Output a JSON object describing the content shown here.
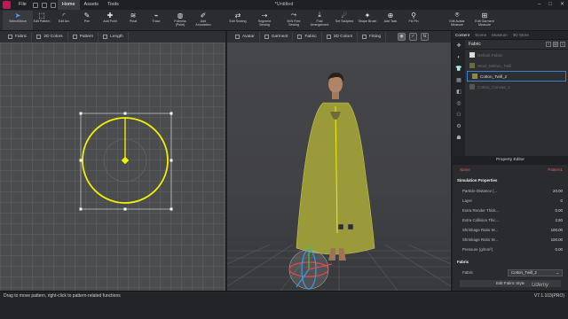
{
  "menubar": {
    "items": [
      "File",
      "Home",
      "Assets",
      "Tools"
    ],
    "active": "Home",
    "doc_title": "*Untitled",
    "window_buttons": [
      "–",
      "□",
      "✕"
    ]
  },
  "toolbar": {
    "tools": [
      {
        "label": "Select/Move",
        "icon": "cursor-icon",
        "glyph": "➤"
      },
      {
        "label": "Edit Pattern",
        "icon": "edit-pattern-icon",
        "glyph": "⬚"
      },
      {
        "label": "Edit Arc",
        "icon": "edit-arc-icon",
        "glyph": "◜"
      },
      {
        "label": "Pen",
        "icon": "pen-icon",
        "glyph": "✎"
      },
      {
        "label": "Add Point",
        "icon": "add-point-icon",
        "glyph": "✚"
      },
      {
        "label": "Pleat",
        "icon": "pleat-icon",
        "glyph": "≋"
      },
      {
        "label": "Trace",
        "icon": "trace-icon",
        "glyph": "⌁"
      },
      {
        "label": "Fullness\n(Point)",
        "icon": "fullness-icon",
        "glyph": "◍"
      },
      {
        "label": "Add\nAnnotation",
        "icon": "annotation-icon",
        "glyph": "✐"
      },
      {
        "label": "Edit Sewing",
        "icon": "edit-sewing-icon",
        "glyph": "⇄"
      },
      {
        "label": "Segment\nSewing",
        "icon": "segment-sewing-icon",
        "glyph": "⇢"
      },
      {
        "label": "M:N Free\nSewing",
        "icon": "free-sewing-icon",
        "glyph": "⤳"
      },
      {
        "label": "Fold\nArrangement",
        "icon": "fold-icon",
        "glyph": "⤓"
      },
      {
        "label": "Set Sculpted",
        "icon": "sculpt-icon",
        "glyph": "☄"
      },
      {
        "label": "Shape Brush",
        "icon": "brush-icon",
        "glyph": "✦"
      },
      {
        "label": "Add Tack",
        "icon": "tack-icon",
        "glyph": "⊕"
      },
      {
        "label": "Fix Pin",
        "icon": "pin-icon",
        "glyph": "⚲"
      },
      {
        "label": "Edit Avatar\nMeasure",
        "icon": "avatar-measure-icon",
        "glyph": "⍟"
      },
      {
        "label": "Edit Garment\nMeasure",
        "icon": "garment-measure-icon",
        "glyph": "⊞"
      }
    ]
  },
  "panel2d": {
    "tabs": [
      "Fabric",
      "2D Colors",
      "Pattern",
      "Length"
    ]
  },
  "panel3d": {
    "tabs": [
      "Avatar",
      "Garment",
      "Fabric",
      "3D Colors",
      "Fitting"
    ],
    "controls": [
      "◉",
      "✓",
      "⇅"
    ]
  },
  "right": {
    "tabs": [
      "Content",
      "Scene",
      "Museum",
      "3D Store"
    ],
    "list_title": "Fabric",
    "list_actions": [
      "+",
      "▤",
      "⇩"
    ],
    "fabrics": [
      {
        "name": "Default Fabric",
        "state": "dim"
      },
      {
        "name": "Wool_Melton_Twill",
        "state": "dim"
      },
      {
        "name": "Cotton_Twill_2",
        "state": "selected"
      },
      {
        "name": "Cotton_Canvas_1",
        "state": "dim"
      }
    ],
    "side_icons": [
      "✚",
      "◐",
      "👕",
      "▦",
      "◧",
      "◎",
      "⚇",
      "⚙",
      "☗"
    ]
  },
  "property_editor": {
    "title": "Property Editor",
    "name_label": "Name",
    "name_value": "Pattern1",
    "section_sim": "Simulation Properties",
    "rows": [
      {
        "label": "Particle Distance (...",
        "value": "20.00"
      },
      {
        "label": "Layer",
        "value": "0"
      },
      {
        "label": "Extra Render Thick...",
        "value": "0.00"
      },
      {
        "label": "Extra Collision Thic...",
        "value": "2.50"
      },
      {
        "label": "Shrinkage Ratio W...",
        "value": "100.00"
      },
      {
        "label": "Shrinkage Ratio W...",
        "value": "100.00"
      },
      {
        "label": "Pressure (g/mm²)",
        "value": "0.00"
      }
    ],
    "section_fabric": "Fabric",
    "fabric_label": "Fabric",
    "fabric_value": "Cotton_Twill_2",
    "edit_button": "Edit Fabric Style"
  },
  "status": {
    "message": "Drag to move pattern, right-click to pattern-related functions",
    "version": "V7.1.103(PRO)",
    "watermark": "Udemy"
  },
  "colors": {
    "pattern_outline": "#f0f000",
    "garment_fill": "#9a9a3a",
    "selection": "#3d7fd1",
    "accent_red": "#e06060"
  }
}
